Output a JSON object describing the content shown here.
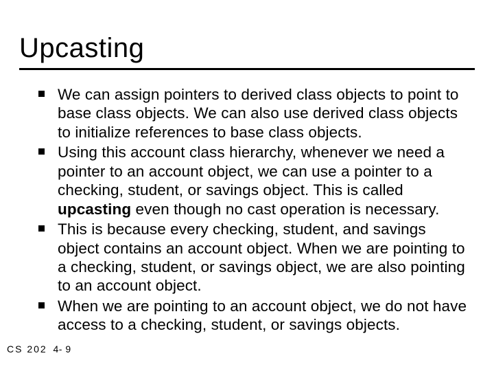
{
  "title": "Upcasting",
  "bullets": [
    "We can assign pointers to derived class objects to point to base class objects. We can also use derived class objects to initialize references to base class objects.",
    "Using this account class hierarchy, whenever we need a pointer to an account object, we can use a pointer to a checking, student, or savings object. This is called <b>upcasting</b> even though no cast operation is necessary.",
    "This is because every checking, student, and savings object contains an account object. When we are pointing to a checking, student, or savings object, we are also pointing to an account object.",
    "When we are pointing to an account object, we do not have access to a checking, student, or savings objects."
  ],
  "footer": {
    "course": "CS 202",
    "page": "4- 9"
  }
}
